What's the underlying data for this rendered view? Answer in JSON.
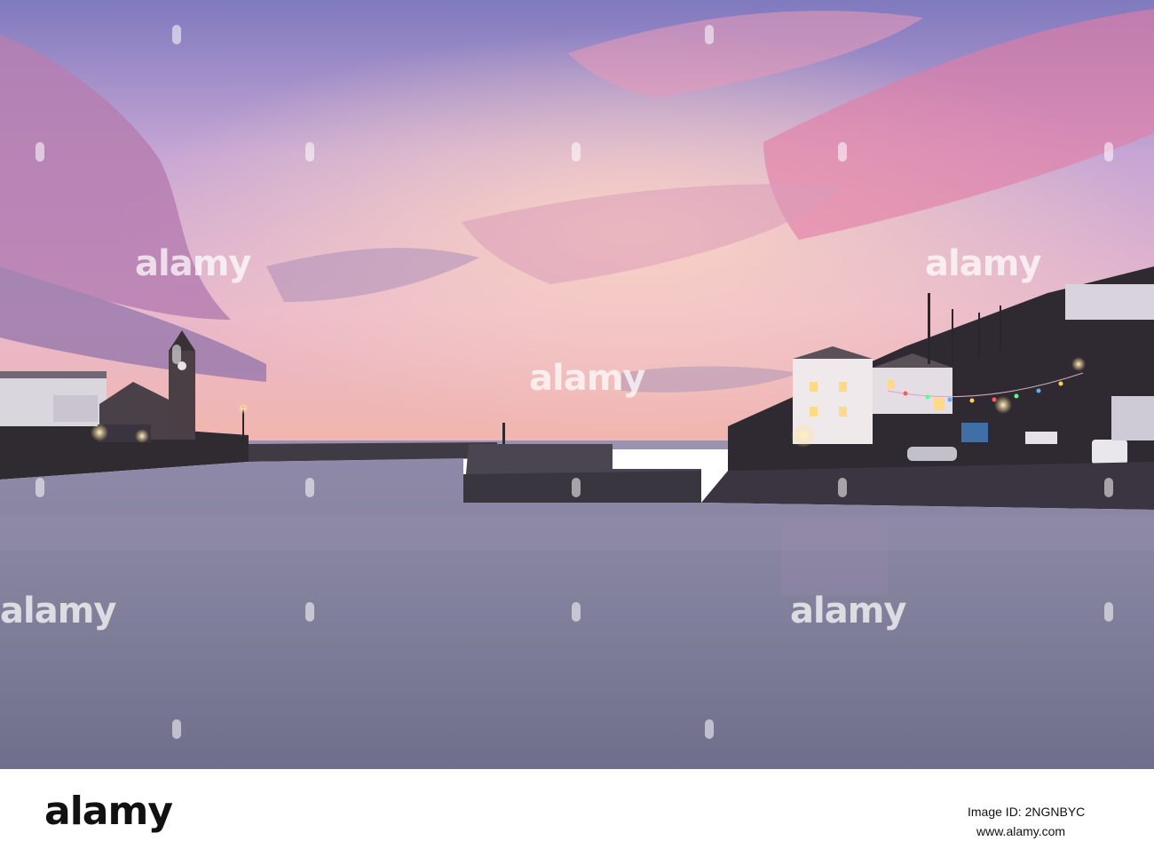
{
  "photo": {
    "subject": "harbour-at-sunset",
    "colors": {
      "sky_top": "#8e86c4",
      "sky_mid": "#e6b9d6",
      "horizon_glow": "#f4b0a6",
      "cloud_pink": "#e07ea8",
      "water": "#7e7f99",
      "harbour_wall": "#3e3a42",
      "lit_window": "#ffd98a"
    }
  },
  "watermark": {
    "text": "alamy"
  },
  "footer": {
    "logo": "alamy",
    "image_id": "Image ID: 2NGNBYC",
    "url": "www.alamy.com"
  }
}
